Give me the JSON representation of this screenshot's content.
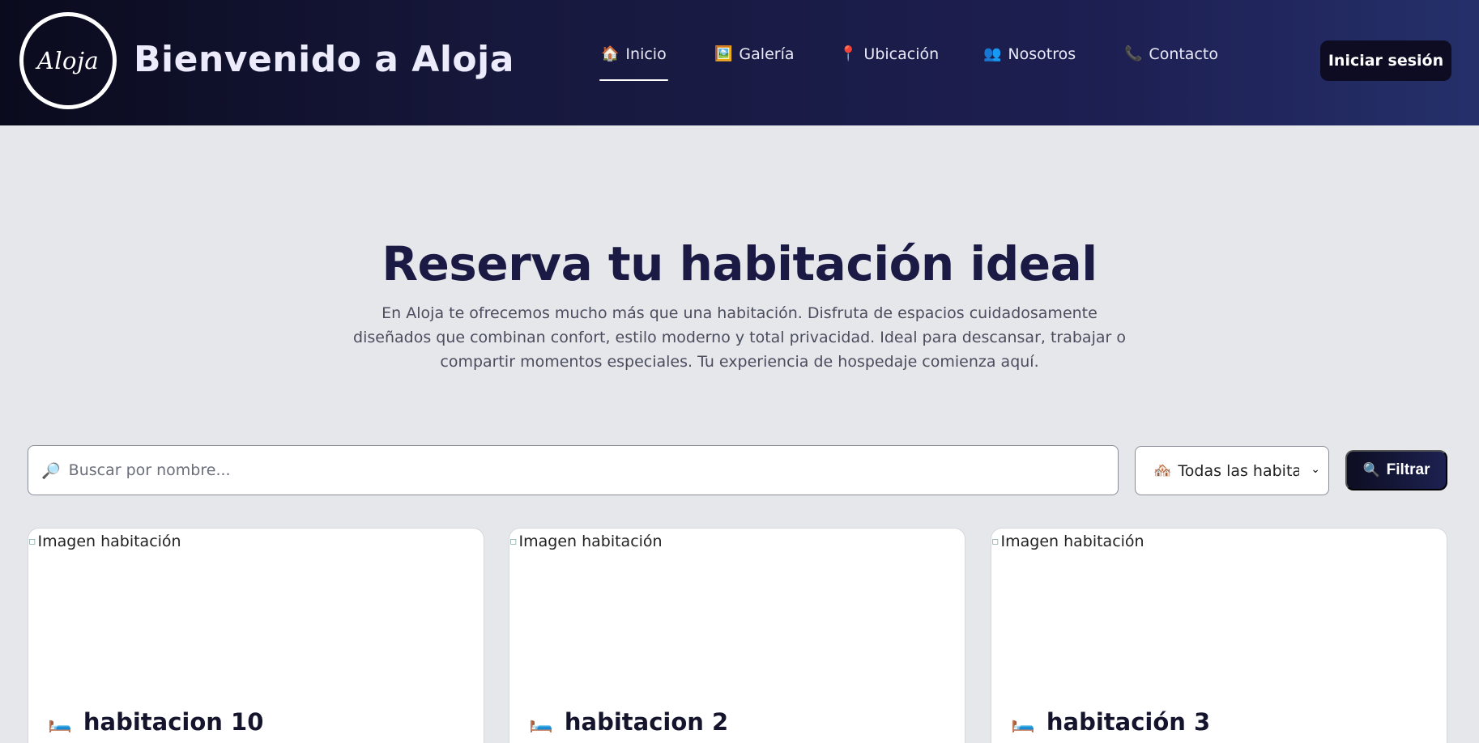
{
  "header": {
    "logo_text": "Aloja",
    "title": "Bienvenido a Aloja",
    "nav": [
      {
        "icon": "🏠",
        "label": "Inicio",
        "active": true
      },
      {
        "icon": "🖼️",
        "label": "Galería",
        "active": false
      },
      {
        "icon": "📍",
        "label": "Ubicación",
        "active": false
      },
      {
        "icon": "👥",
        "label": "Nosotros",
        "active": false
      },
      {
        "icon": "📞",
        "label": "Contacto",
        "active": false
      }
    ],
    "login_label": "Iniciar sesión"
  },
  "hero": {
    "title": "Reserva tu habitación ideal",
    "text": "En Aloja te ofrecemos mucho más que una habitación. Disfruta de espacios cuidadosamente diseñados que combinan confort, estilo moderno y total privacidad. Ideal para descansar, trabajar o compartir momentos especiales. Tu experiencia de hospedaje comienza aquí."
  },
  "search": {
    "icon": "🔎",
    "placeholder": "Buscar por nombre...",
    "value": ""
  },
  "type_filter": {
    "icon": "🏘️",
    "selected": "Todas las habitac"
  },
  "filter_button": {
    "icon": "🔍",
    "label": "Filtrar"
  },
  "rooms": [
    {
      "image_alt": "Imagen habitación",
      "icon": "🛏️",
      "name": "habitacion 10"
    },
    {
      "image_alt": "Imagen habitación",
      "icon": "🛏️",
      "name": "habitacion 2"
    },
    {
      "image_alt": "Imagen habitación",
      "icon": "🛏️",
      "name": "habitación 3"
    }
  ]
}
